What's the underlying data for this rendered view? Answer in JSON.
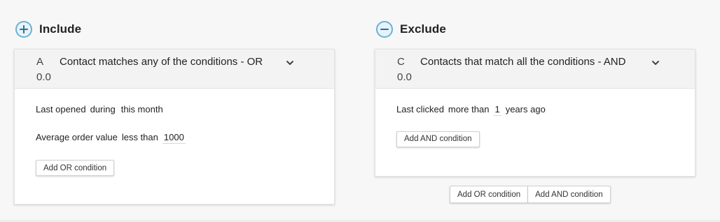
{
  "include": {
    "title": "Include",
    "icon": "plus-circle-icon",
    "group": {
      "letter": "A",
      "title": "Contact matches any of the conditions - OR",
      "score": "0.0",
      "conditions": [
        {
          "field": "Last opened",
          "operator": "during",
          "value": "this month",
          "suffix": ""
        },
        {
          "field": "Average order value",
          "operator": "less than",
          "value": "1000",
          "suffix": ""
        }
      ],
      "add_button": "Add OR condition"
    }
  },
  "exclude": {
    "title": "Exclude",
    "icon": "minus-circle-icon",
    "group": {
      "letter": "C",
      "title": "Contacts that match all the conditions - AND",
      "score": "0.0",
      "conditions": [
        {
          "field": "Last clicked",
          "operator": "more than",
          "value": "1",
          "suffix": "years ago"
        }
      ],
      "add_button": "Add AND condition"
    },
    "bottom_buttons": {
      "add_or": "Add OR condition",
      "add_and": "Add AND condition"
    }
  },
  "colors": {
    "icon_border": "#6ab2d6",
    "icon_fill": "#e7f3fa",
    "icon_glyph": "#2c6f94",
    "card_header": "#f3f3f3",
    "background": "#f7f7f7"
  }
}
